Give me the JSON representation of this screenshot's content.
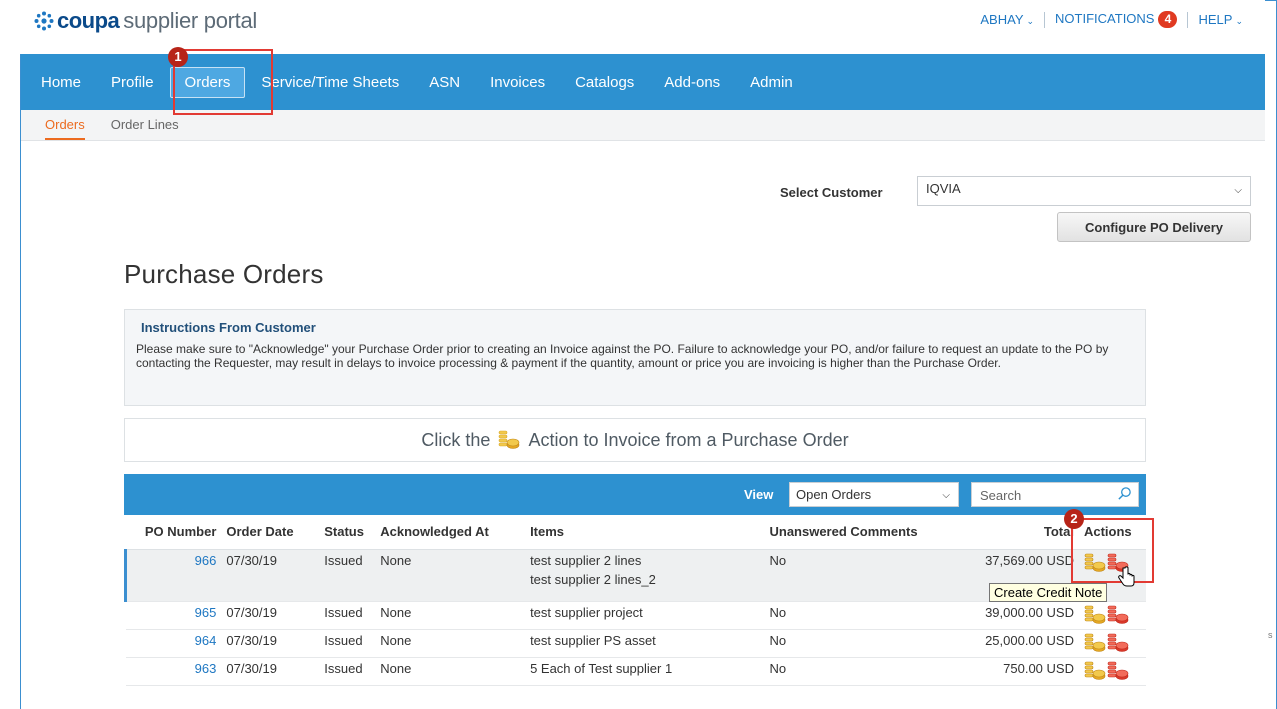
{
  "header": {
    "logo_word": "coupa",
    "logo_suffix": "supplier portal",
    "user": "ABHAY",
    "notifications_label": "NOTIFICATIONS",
    "notifications_count": "4",
    "help": "HELP"
  },
  "nav": {
    "items": [
      "Home",
      "Profile",
      "Orders",
      "Service/Time Sheets",
      "ASN",
      "Invoices",
      "Catalogs",
      "Add-ons",
      "Admin"
    ],
    "active": "Orders"
  },
  "subnav": {
    "items": [
      "Orders",
      "Order Lines"
    ]
  },
  "customer": {
    "label": "Select Customer",
    "value": "IQVIA",
    "configure_button": "Configure PO Delivery"
  },
  "page_title": "Purchase Orders",
  "instructions": {
    "title": "Instructions From Customer",
    "text": "Please make sure to \"Acknowledge\" your Purchase Order prior to creating an Invoice against the PO. Failure to acknowledge your PO, and/or failure to request an update to the PO by contacting the Requester, may result in delays to invoice processing & payment if the quantity, amount or price you are invoicing is higher than the Purchase Order."
  },
  "hint": {
    "before": "Click the",
    "after": "Action to Invoice from a Purchase Order"
  },
  "table": {
    "view_label": "View",
    "view_value": "Open Orders",
    "search_placeholder": "Search",
    "columns": [
      "PO Number",
      "Order Date",
      "Status",
      "Acknowledged At",
      "Items",
      "Unanswered Comments",
      "Total",
      "Actions"
    ],
    "rows": [
      {
        "po": "966",
        "date": "07/30/19",
        "status": "Issued",
        "ack": "None",
        "items": "test supplier 2 lines",
        "items2": "test supplier 2 lines_2",
        "comments": "No",
        "total": "37,569.00 USD"
      },
      {
        "po": "965",
        "date": "07/30/19",
        "status": "Issued",
        "ack": "None",
        "items": "test supplier project",
        "items2": "",
        "comments": "No",
        "total": "39,000.00 USD"
      },
      {
        "po": "964",
        "date": "07/30/19",
        "status": "Issued",
        "ack": "None",
        "items": "test supplier PS asset",
        "items2": "",
        "comments": "No",
        "total": "25,000.00 USD"
      },
      {
        "po": "963",
        "date": "07/30/19",
        "status": "Issued",
        "ack": "None",
        "items": "5 Each of Test supplier 1",
        "items2": "",
        "comments": "No",
        "total": "750.00 USD"
      }
    ]
  },
  "tooltip": "Create Credit Note",
  "markers": [
    "1",
    "2"
  ],
  "colors": {
    "nav": "#2d91d0",
    "accent_orange": "#ec6b1f",
    "highlight_red": "#e23a33",
    "link": "#1e77c2"
  },
  "icons": {
    "invoice_action": "gold-coins-icon",
    "credit_note_action": "red-coins-icon"
  }
}
